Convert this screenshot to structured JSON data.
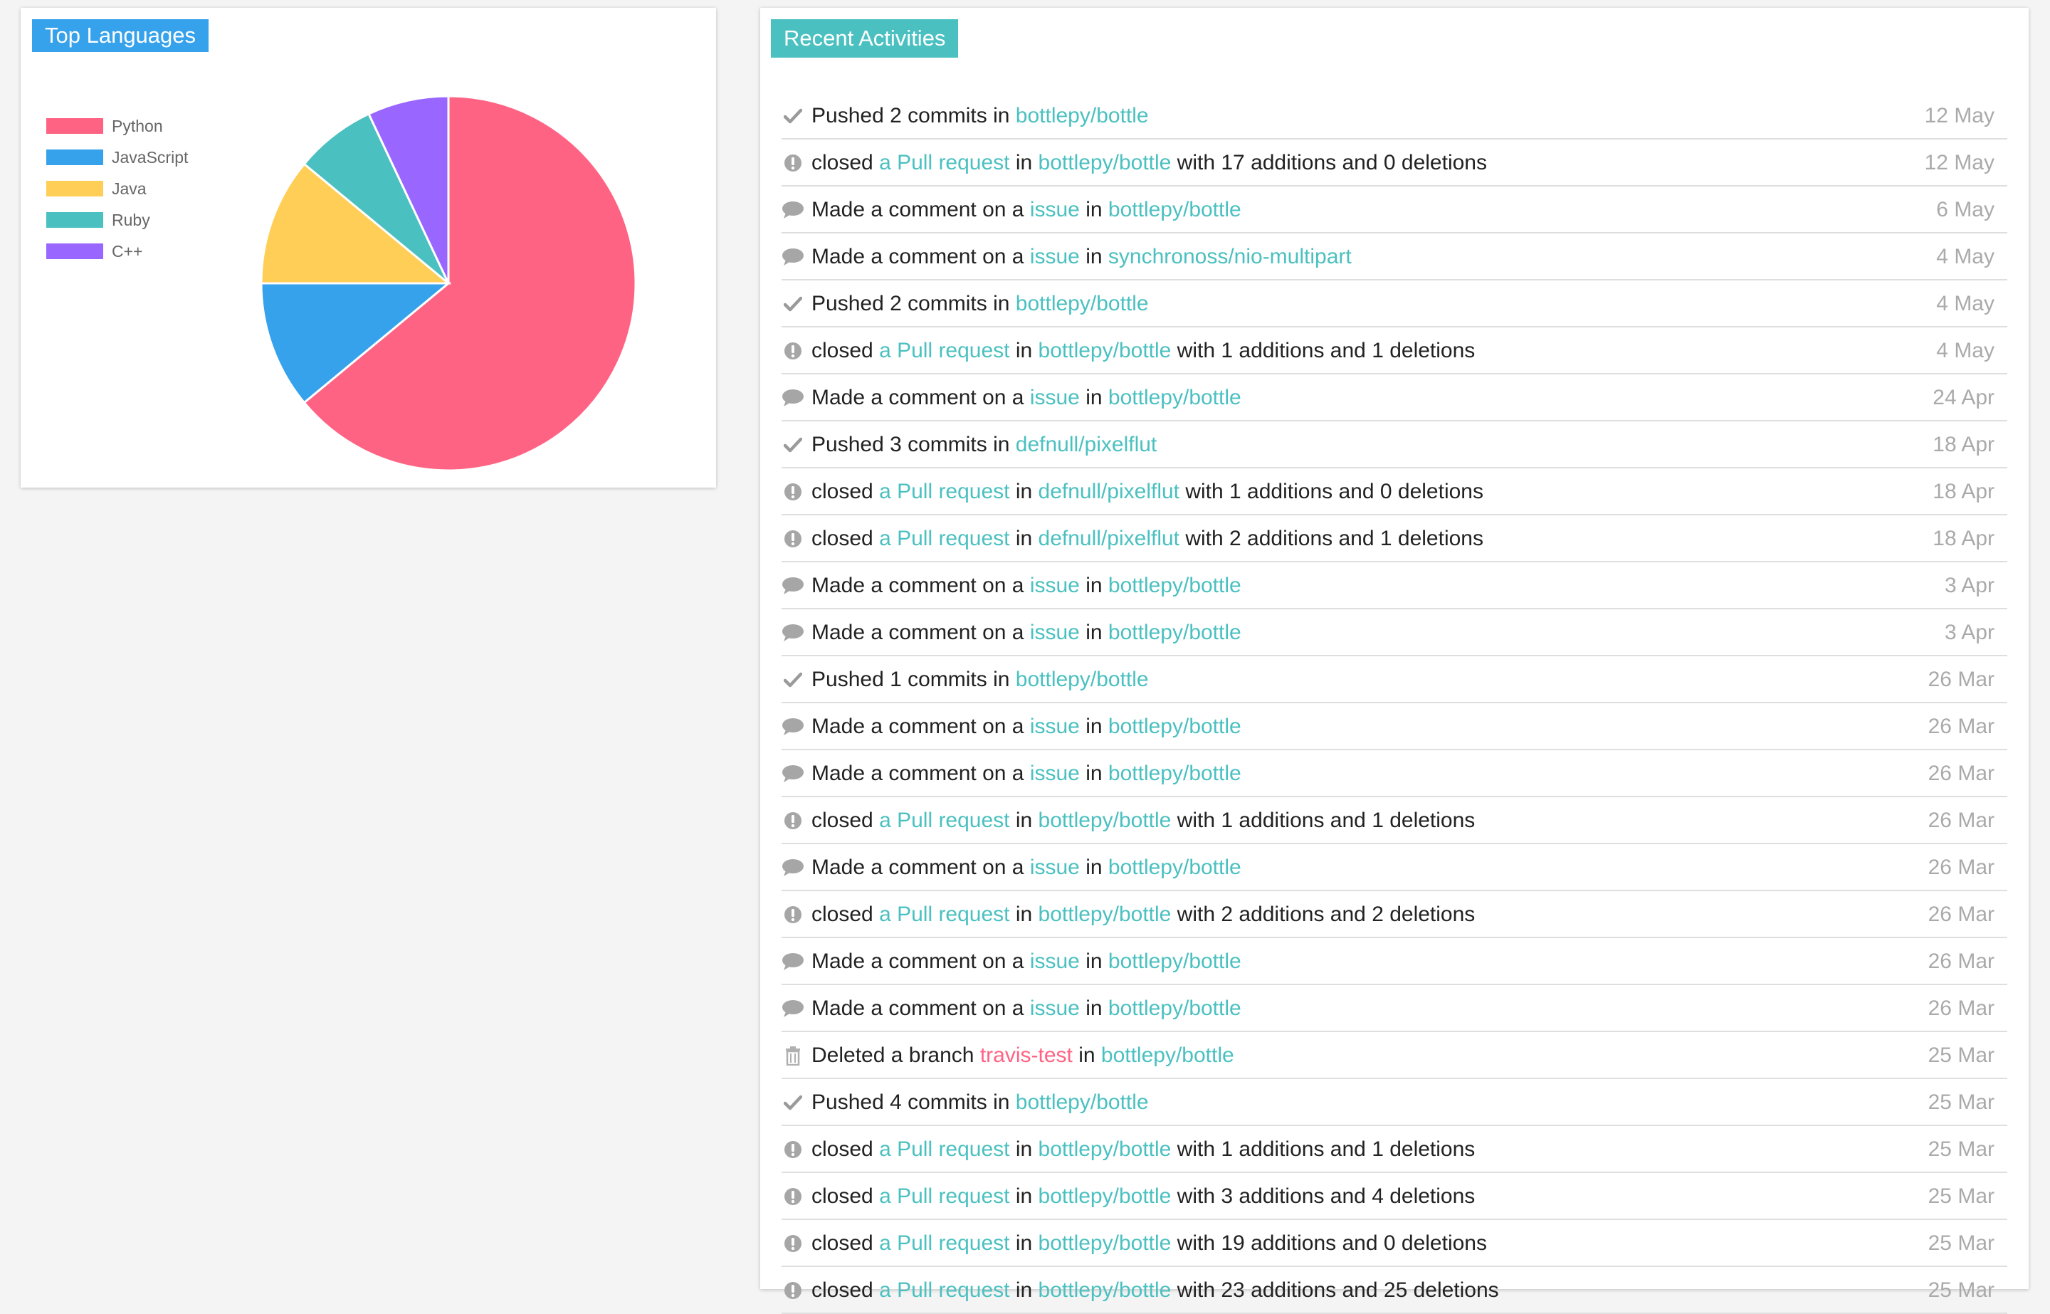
{
  "languages": {
    "title": "Top Languages",
    "chart_data": {
      "type": "pie",
      "categories": [
        "Python",
        "JavaScript",
        "Java",
        "Ruby",
        "C++"
      ],
      "values": [
        64,
        11,
        11,
        7,
        7
      ],
      "colors": [
        "#ff6384",
        "#36a2eb",
        "#ffce56",
        "#4bc0c0",
        "#9966ff"
      ],
      "legend_position": "left"
    }
  },
  "activities": {
    "title": "Recent Activities",
    "items": [
      {
        "icon": "check-icon",
        "parts": [
          {
            "t": "Pushed 2 commits in "
          },
          {
            "t": "bottlepy/bottle",
            "c": "link"
          }
        ],
        "date": "12 May"
      },
      {
        "icon": "exclamation-icon",
        "parts": [
          {
            "t": "closed "
          },
          {
            "t": "a Pull request",
            "c": "link"
          },
          {
            "t": " in "
          },
          {
            "t": "bottlepy/bottle",
            "c": "link"
          },
          {
            "t": " with 17 additions and 0 deletions"
          }
        ],
        "date": "12 May"
      },
      {
        "icon": "comment-icon",
        "parts": [
          {
            "t": "Made a comment on a "
          },
          {
            "t": "issue",
            "c": "link"
          },
          {
            "t": " in "
          },
          {
            "t": "bottlepy/bottle",
            "c": "link"
          }
        ],
        "date": "6 May"
      },
      {
        "icon": "comment-icon",
        "parts": [
          {
            "t": "Made a comment on a "
          },
          {
            "t": "issue",
            "c": "link"
          },
          {
            "t": " in "
          },
          {
            "t": "synchronoss/nio-multipart",
            "c": "link"
          }
        ],
        "date": "4 May"
      },
      {
        "icon": "check-icon",
        "parts": [
          {
            "t": "Pushed 2 commits in "
          },
          {
            "t": "bottlepy/bottle",
            "c": "link"
          }
        ],
        "date": "4 May"
      },
      {
        "icon": "exclamation-icon",
        "parts": [
          {
            "t": "closed "
          },
          {
            "t": "a Pull request",
            "c": "link"
          },
          {
            "t": " in "
          },
          {
            "t": "bottlepy/bottle",
            "c": "link"
          },
          {
            "t": " with 1 additions and 1 deletions"
          }
        ],
        "date": "4 May"
      },
      {
        "icon": "comment-icon",
        "parts": [
          {
            "t": "Made a comment on a "
          },
          {
            "t": "issue",
            "c": "link"
          },
          {
            "t": " in "
          },
          {
            "t": "bottlepy/bottle",
            "c": "link"
          }
        ],
        "date": "24 Apr"
      },
      {
        "icon": "check-icon",
        "parts": [
          {
            "t": "Pushed 3 commits in "
          },
          {
            "t": "defnull/pixelflut",
            "c": "link"
          }
        ],
        "date": "18 Apr"
      },
      {
        "icon": "exclamation-icon",
        "parts": [
          {
            "t": "closed "
          },
          {
            "t": "a Pull request",
            "c": "link"
          },
          {
            "t": " in "
          },
          {
            "t": "defnull/pixelflut",
            "c": "link"
          },
          {
            "t": " with 1 additions and 0 deletions"
          }
        ],
        "date": "18 Apr"
      },
      {
        "icon": "exclamation-icon",
        "parts": [
          {
            "t": "closed "
          },
          {
            "t": "a Pull request",
            "c": "link"
          },
          {
            "t": " in "
          },
          {
            "t": "defnull/pixelflut",
            "c": "link"
          },
          {
            "t": " with 2 additions and 1 deletions"
          }
        ],
        "date": "18 Apr"
      },
      {
        "icon": "comment-icon",
        "parts": [
          {
            "t": "Made a comment on a "
          },
          {
            "t": "issue",
            "c": "link"
          },
          {
            "t": " in "
          },
          {
            "t": "bottlepy/bottle",
            "c": "link"
          }
        ],
        "date": "3 Apr"
      },
      {
        "icon": "comment-icon",
        "parts": [
          {
            "t": "Made a comment on a "
          },
          {
            "t": "issue",
            "c": "link"
          },
          {
            "t": " in "
          },
          {
            "t": "bottlepy/bottle",
            "c": "link"
          }
        ],
        "date": "3 Apr"
      },
      {
        "icon": "check-icon",
        "parts": [
          {
            "t": "Pushed 1 commits in "
          },
          {
            "t": "bottlepy/bottle",
            "c": "link"
          }
        ],
        "date": "26 Mar"
      },
      {
        "icon": "comment-icon",
        "parts": [
          {
            "t": "Made a comment on a "
          },
          {
            "t": "issue",
            "c": "link"
          },
          {
            "t": " in "
          },
          {
            "t": "bottlepy/bottle",
            "c": "link"
          }
        ],
        "date": "26 Mar"
      },
      {
        "icon": "comment-icon",
        "parts": [
          {
            "t": "Made a comment on a "
          },
          {
            "t": "issue",
            "c": "link"
          },
          {
            "t": " in "
          },
          {
            "t": "bottlepy/bottle",
            "c": "link"
          }
        ],
        "date": "26 Mar"
      },
      {
        "icon": "exclamation-icon",
        "parts": [
          {
            "t": "closed "
          },
          {
            "t": "a Pull request",
            "c": "link"
          },
          {
            "t": " in "
          },
          {
            "t": "bottlepy/bottle",
            "c": "link"
          },
          {
            "t": " with 1 additions and 1 deletions"
          }
        ],
        "date": "26 Mar"
      },
      {
        "icon": "comment-icon",
        "parts": [
          {
            "t": "Made a comment on a "
          },
          {
            "t": "issue",
            "c": "link"
          },
          {
            "t": " in "
          },
          {
            "t": "bottlepy/bottle",
            "c": "link"
          }
        ],
        "date": "26 Mar"
      },
      {
        "icon": "exclamation-icon",
        "parts": [
          {
            "t": "closed "
          },
          {
            "t": "a Pull request",
            "c": "link"
          },
          {
            "t": " in "
          },
          {
            "t": "bottlepy/bottle",
            "c": "link"
          },
          {
            "t": " with 2 additions and 2 deletions"
          }
        ],
        "date": "26 Mar"
      },
      {
        "icon": "comment-icon",
        "parts": [
          {
            "t": "Made a comment on a "
          },
          {
            "t": "issue",
            "c": "link"
          },
          {
            "t": " in "
          },
          {
            "t": "bottlepy/bottle",
            "c": "link"
          }
        ],
        "date": "26 Mar"
      },
      {
        "icon": "comment-icon",
        "parts": [
          {
            "t": "Made a comment on a "
          },
          {
            "t": "issue",
            "c": "link"
          },
          {
            "t": " in "
          },
          {
            "t": "bottlepy/bottle",
            "c": "link"
          }
        ],
        "date": "26 Mar"
      },
      {
        "icon": "trash-icon",
        "parts": [
          {
            "t": "Deleted a branch "
          },
          {
            "t": "travis-test",
            "c": "branch"
          },
          {
            "t": " in "
          },
          {
            "t": "bottlepy/bottle",
            "c": "link"
          }
        ],
        "date": "25 Mar"
      },
      {
        "icon": "check-icon",
        "parts": [
          {
            "t": "Pushed 4 commits in "
          },
          {
            "t": "bottlepy/bottle",
            "c": "link"
          }
        ],
        "date": "25 Mar"
      },
      {
        "icon": "exclamation-icon",
        "parts": [
          {
            "t": "closed "
          },
          {
            "t": "a Pull request",
            "c": "link"
          },
          {
            "t": " in "
          },
          {
            "t": "bottlepy/bottle",
            "c": "link"
          },
          {
            "t": " with 1 additions and 1 deletions"
          }
        ],
        "date": "25 Mar"
      },
      {
        "icon": "exclamation-icon",
        "parts": [
          {
            "t": "closed "
          },
          {
            "t": "a Pull request",
            "c": "link"
          },
          {
            "t": " in "
          },
          {
            "t": "bottlepy/bottle",
            "c": "link"
          },
          {
            "t": " with 3 additions and 4 deletions"
          }
        ],
        "date": "25 Mar"
      },
      {
        "icon": "exclamation-icon",
        "parts": [
          {
            "t": "closed "
          },
          {
            "t": "a Pull request",
            "c": "link"
          },
          {
            "t": " in "
          },
          {
            "t": "bottlepy/bottle",
            "c": "link"
          },
          {
            "t": " with 19 additions and 0 deletions"
          }
        ],
        "date": "25 Mar"
      },
      {
        "icon": "exclamation-icon",
        "parts": [
          {
            "t": "closed "
          },
          {
            "t": "a Pull request",
            "c": "link"
          },
          {
            "t": " in "
          },
          {
            "t": "bottlepy/bottle",
            "c": "link"
          },
          {
            "t": " with 23 additions and 25 deletions"
          }
        ],
        "date": "25 Mar"
      }
    ]
  }
}
